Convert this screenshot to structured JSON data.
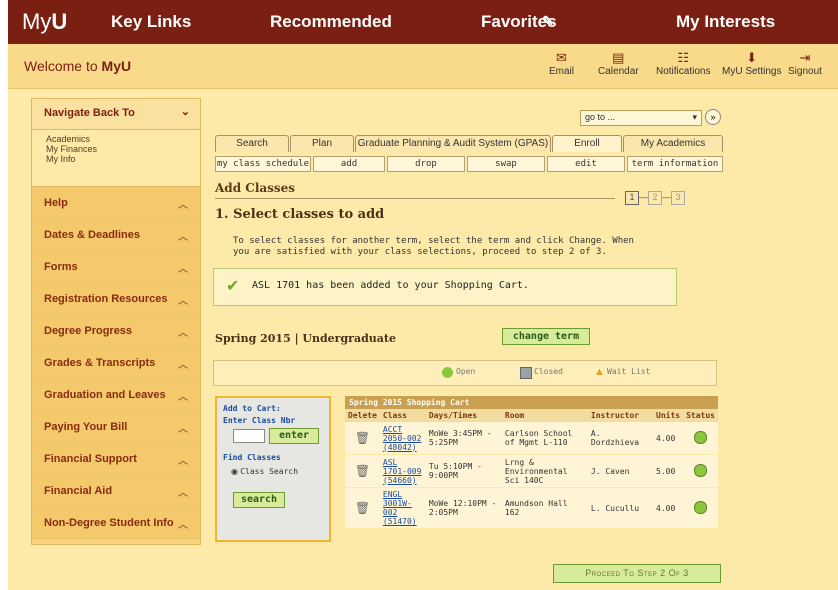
{
  "topnav": {
    "brand_plain": "My",
    "brand_bold": "U",
    "items": [
      "Key Links",
      "Recommended",
      "Favorites",
      "My Interests"
    ],
    "favorites_edit_icon": "pencil-icon"
  },
  "welcome": {
    "prefix": "Welcome to ",
    "bold": "MyU",
    "tools": [
      "Email",
      "Calendar",
      "Notifications",
      "MyU Settings",
      "Signout"
    ]
  },
  "sidebar": {
    "head": "Navigate Back To",
    "links": [
      "Academics",
      "My Finances",
      "My Info"
    ],
    "items": [
      "Help",
      "Dates & Deadlines",
      "Forms",
      "Registration Resources",
      "Degree Progress",
      "Grades & Transcripts",
      "Graduation and Leaves",
      "Paying Your Bill",
      "Financial Support",
      "Financial Aid",
      "Non-Degree Student Info"
    ]
  },
  "main": {
    "goto_placeholder": "go to ...",
    "goto_btn": "»",
    "tabs": [
      "Search",
      "Plan",
      "Graduate Planning & Audit System (GPAS)",
      "Enroll",
      "My Academics"
    ],
    "subtabs": [
      "my class schedule",
      "add",
      "drop",
      "swap",
      "edit",
      "term information"
    ],
    "section_title": "Add Classes",
    "steps": [
      "1",
      "2",
      "3"
    ],
    "step_title": "1.  Select classes to add",
    "instructions": "To select classes for another term, select the term and click Change.  When you are satisfied with your class selections, proceed to step 2 of 3.",
    "confirmation": "ASL 1701 has been added to your Shopping Cart.",
    "term": "Spring 2015 | Undergraduate",
    "change_term": "change term",
    "legend": [
      "Open",
      "Closed",
      "Wait List"
    ],
    "add_to_cart": "Add to Cart:",
    "enter_class_nbr": "Enter Class Nbr",
    "enter_btn": "enter",
    "find_classes": "Find Classes",
    "class_search": "Class Search",
    "search_btn": "search",
    "cart_title": "Spring 2015 Shopping Cart",
    "cart_headers": [
      "Delete",
      "Class",
      "Days/Times",
      "Room",
      "Instructor",
      "Units",
      "Status"
    ],
    "cart_rows": [
      {
        "class": "ACCT 2050-002 (48042)",
        "days": "MoWe 3:45PM - 5:25PM",
        "room": "Carlson School of Mgmt L-110",
        "instructor": "A. Dordzhieva",
        "units": "4.00"
      },
      {
        "class": "ASL 1701-009 (54660)",
        "days": "Tu 5:10PM - 9:00PM",
        "room": "Lrng & Environmental Sci 140C",
        "instructor": "J. Caven",
        "units": "5.00"
      },
      {
        "class": "ENGL 3001W-002 (51470)",
        "days": "MoWe 12:10PM - 2:05PM",
        "room": "Amundson Hall 162",
        "instructor": "L. Cucullu",
        "units": "4.00"
      }
    ],
    "proceed": "Proceed To Step 2 Of 3"
  }
}
